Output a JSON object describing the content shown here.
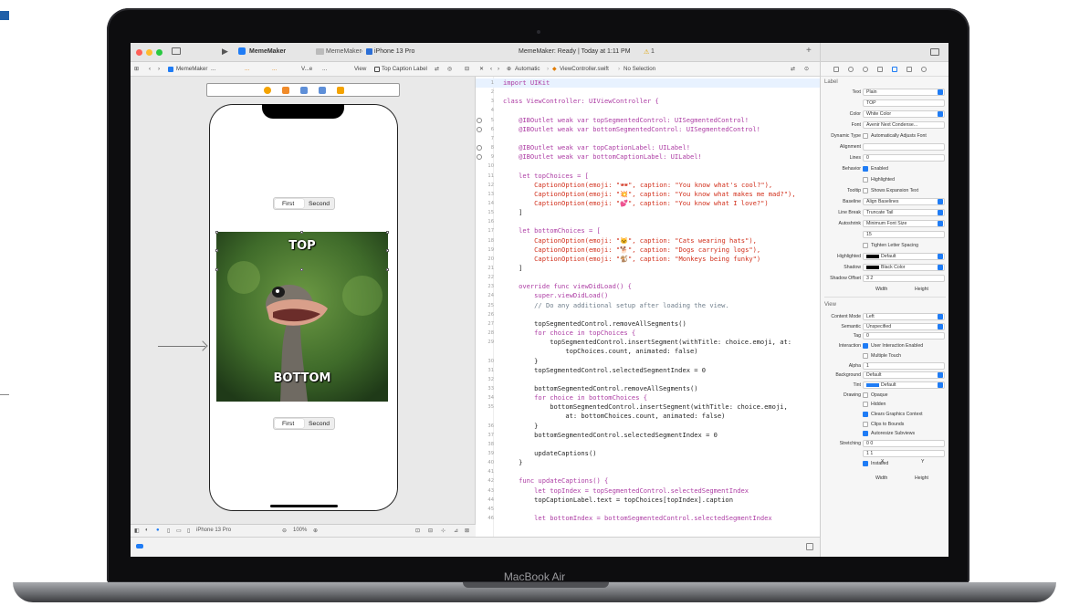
{
  "laptop": {
    "brand": "MacBook Air"
  },
  "titlebar": {
    "app_name": "MemeMaker",
    "scheme": "MemeMaker",
    "device": "iPhone 13 Pro",
    "status": "MemeMaker: Ready | Today at 1:11 PM",
    "warnings": "1"
  },
  "left_jumpbar": {
    "items": [
      "MemeMaker",
      "...",
      "...",
      "...",
      "V...e",
      "...",
      "View",
      "Top Caption Label"
    ]
  },
  "right_jumpbar": {
    "items": [
      "Automatic",
      "ViewController.swift",
      "No Selection"
    ]
  },
  "canvas": {
    "segment_top": [
      "First",
      "Second"
    ],
    "segment_bottom": [
      "First",
      "Second"
    ],
    "top_caption": "TOP",
    "bottom_caption": "BOTTOM",
    "device_label": "iPhone 13 Pro",
    "zoom": "100%"
  },
  "code": [
    {
      "n": "1",
      "t": "import UIKit",
      "hl": true
    },
    {
      "n": "2",
      "t": ""
    },
    {
      "n": "3",
      "t": "class ViewController: UIViewController {"
    },
    {
      "n": "4",
      "t": ""
    },
    {
      "n": "5",
      "t": "    @IBOutlet weak var topSegmentedControl: UISegmentedControl!",
      "dot": true
    },
    {
      "n": "6",
      "t": "    @IBOutlet weak var bottomSegmentedControl: UISegmentedControl!",
      "dot": true
    },
    {
      "n": "7",
      "t": ""
    },
    {
      "n": "8",
      "t": "    @IBOutlet weak var topCaptionLabel: UILabel!",
      "dot": true
    },
    {
      "n": "9",
      "t": "    @IBOutlet weak var bottomCaptionLabel: UILabel!",
      "dot": true
    },
    {
      "n": "10",
      "t": ""
    },
    {
      "n": "11",
      "t": "    let topChoices = ["
    },
    {
      "n": "12",
      "t": "        CaptionOption(emoji: \"🕶\", caption: \"You know what's cool?\"),"
    },
    {
      "n": "13",
      "t": "        CaptionOption(emoji: \"💥\", caption: \"You know what makes me mad?\"),"
    },
    {
      "n": "14",
      "t": "        CaptionOption(emoji: \"💕\", caption: \"You know what I love?\")"
    },
    {
      "n": "15",
      "t": "    ]"
    },
    {
      "n": "16",
      "t": ""
    },
    {
      "n": "17",
      "t": "    let bottomChoices = ["
    },
    {
      "n": "18",
      "t": "        CaptionOption(emoji: \"🐱\", caption: \"Cats wearing hats\"),"
    },
    {
      "n": "19",
      "t": "        CaptionOption(emoji: \"🐕\", caption: \"Dogs carrying logs\"),"
    },
    {
      "n": "20",
      "t": "        CaptionOption(emoji: \"🐒\", caption: \"Monkeys being funky\")"
    },
    {
      "n": "21",
      "t": "    ]"
    },
    {
      "n": "22",
      "t": ""
    },
    {
      "n": "23",
      "t": "    override func viewDidLoad() {"
    },
    {
      "n": "24",
      "t": "        super.viewDidLoad()"
    },
    {
      "n": "25",
      "t": "        // Do any additional setup after loading the view."
    },
    {
      "n": "26",
      "t": ""
    },
    {
      "n": "27",
      "t": "        topSegmentedControl.removeAllSegments()"
    },
    {
      "n": "28",
      "t": "        for choice in topChoices {"
    },
    {
      "n": "29",
      "t": "            topSegmentedControl.insertSegment(withTitle: choice.emoji, at:"
    },
    {
      "n": "",
      "t": "                topChoices.count, animated: false)"
    },
    {
      "n": "30",
      "t": "        }"
    },
    {
      "n": "31",
      "t": "        topSegmentedControl.selectedSegmentIndex = 0"
    },
    {
      "n": "32",
      "t": ""
    },
    {
      "n": "33",
      "t": "        bottomSegmentedControl.removeAllSegments()"
    },
    {
      "n": "34",
      "t": "        for choice in bottomChoices {"
    },
    {
      "n": "35",
      "t": "            bottomSegmentedControl.insertSegment(withTitle: choice.emoji,"
    },
    {
      "n": "",
      "t": "                at: bottomChoices.count, animated: false)"
    },
    {
      "n": "36",
      "t": "        }"
    },
    {
      "n": "37",
      "t": "        bottomSegmentedControl.selectedSegmentIndex = 0"
    },
    {
      "n": "38",
      "t": ""
    },
    {
      "n": "39",
      "t": "        updateCaptions()"
    },
    {
      "n": "40",
      "t": "    }"
    },
    {
      "n": "41",
      "t": ""
    },
    {
      "n": "42",
      "t": "    func updateCaptions() {"
    },
    {
      "n": "43",
      "t": "        let topIndex = topSegmentedControl.selectedSegmentIndex"
    },
    {
      "n": "44",
      "t": "        topCaptionLabel.text = topChoices[topIndex].caption"
    },
    {
      "n": "45",
      "t": ""
    },
    {
      "n": "46",
      "t": "        let bottomIndex = bottomSegmentedControl.selectedSegmentIndex"
    }
  ],
  "inspector": {
    "label_section": "Label",
    "view_section": "View",
    "rows": [
      {
        "label": "Text",
        "value": "Plain",
        "pop": true
      },
      {
        "label": "",
        "value": "TOP"
      },
      {
        "label": "Color",
        "value": "White Color",
        "pop": true
      },
      {
        "label": "Font",
        "value": "Avenir Next Condense..."
      },
      {
        "label": "Dynamic Type",
        "check": false,
        "text": "Automatically Adjusts Font"
      },
      {
        "label": "Alignment",
        "value": ""
      },
      {
        "label": "Lines",
        "value": "0"
      },
      {
        "label": "Behavior",
        "check": true,
        "text": "Enabled"
      },
      {
        "label": "",
        "check": false,
        "text": "Highlighted"
      },
      {
        "label": "Tooltip",
        "check": false,
        "text": "Shows Expansion Text"
      },
      {
        "label": "Baseline",
        "value": "Align Baselines",
        "pop": true
      },
      {
        "label": "Line Break",
        "value": "Truncate Tail",
        "pop": true
      },
      {
        "label": "Autoshrink",
        "value": "Minimum Font Size",
        "pop": true
      },
      {
        "label": "",
        "value": "15"
      },
      {
        "label": "",
        "check": false,
        "text": "Tighten Letter Spacing"
      },
      {
        "label": "Highlighted",
        "value": "Default",
        "pop": true,
        "swatch": true
      },
      {
        "label": "Shadow",
        "value": "Black Color",
        "pop": true,
        "swatch": true
      },
      {
        "label": "Shadow Offset",
        "value": "3          2"
      }
    ],
    "offset_sub": [
      "Width",
      "Height"
    ],
    "view_rows": [
      {
        "label": "Content Mode",
        "value": "Left",
        "pop": true
      },
      {
        "label": "Semantic",
        "value": "Unspecified",
        "pop": true
      },
      {
        "label": "Tag",
        "value": "0"
      },
      {
        "label": "Interaction",
        "check": true,
        "text": "User Interaction Enabled"
      },
      {
        "label": "",
        "check": false,
        "text": "Multiple Touch"
      },
      {
        "label": "Alpha",
        "value": "1"
      },
      {
        "label": "Background",
        "value": "Default",
        "pop": true
      },
      {
        "label": "Tint",
        "value": "Default",
        "pop": true,
        "swatch": true
      },
      {
        "label": "Drawing",
        "check": false,
        "text": "Opaque"
      },
      {
        "label": "",
        "check": false,
        "text": "Hidden"
      },
      {
        "label": "",
        "check": true,
        "text": "Clears Graphics Context"
      },
      {
        "label": "",
        "check": false,
        "text": "Clips to Bounds"
      },
      {
        "label": "",
        "check": true,
        "text": "Autoresize Subviews"
      },
      {
        "label": "Stretching",
        "value": "0          0"
      },
      {
        "label": "",
        "value": "1          1"
      },
      {
        "label": "",
        "check": true,
        "text": "Installed"
      }
    ],
    "stretch_sub1": [
      "X",
      "Y"
    ],
    "stretch_sub2": [
      "Width",
      "Height"
    ]
  },
  "colors": {
    "accent": "#1f7cf5",
    "keyword": "#ad3da4",
    "type": "#3900a0",
    "string": "#d12f1b",
    "comment": "#707f8c"
  }
}
